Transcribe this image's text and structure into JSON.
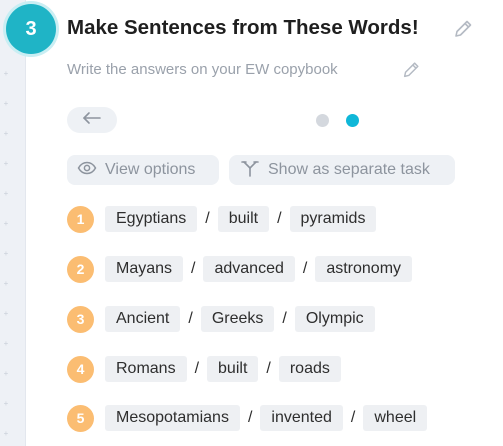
{
  "exercise": {
    "step_number": "3",
    "title": "Make Sentences from These Words!",
    "subtitle": "Write the answers on your EW copybook"
  },
  "navigation": {
    "back_icon": "arrow-left-icon",
    "page_dots": [
      {
        "state": "inactive",
        "color": "#d4d8de"
      },
      {
        "state": "active",
        "color": "#0fb7d8"
      }
    ]
  },
  "options": {
    "view_options_label": "View options",
    "separate_task_label": "Show as separate task"
  },
  "rows": [
    {
      "number": "1",
      "words": [
        "Egyptians",
        "built",
        "pyramids"
      ]
    },
    {
      "number": "2",
      "words": [
        "Mayans",
        "advanced",
        "astronomy"
      ]
    },
    {
      "number": "3",
      "words": [
        "Ancient",
        "Greeks",
        "Olympic"
      ]
    },
    {
      "number": "4",
      "words": [
        "Romans",
        "built",
        "roads"
      ]
    },
    {
      "number": "5",
      "words": [
        "Mesopotamians",
        "invented",
        "wheel"
      ]
    }
  ],
  "separator": "/",
  "colors": {
    "step_badge": "#1fb4c6",
    "number_badge": "#fbbd72",
    "chip_background": "#eef0f3",
    "muted_text": "#9aa1ab"
  }
}
